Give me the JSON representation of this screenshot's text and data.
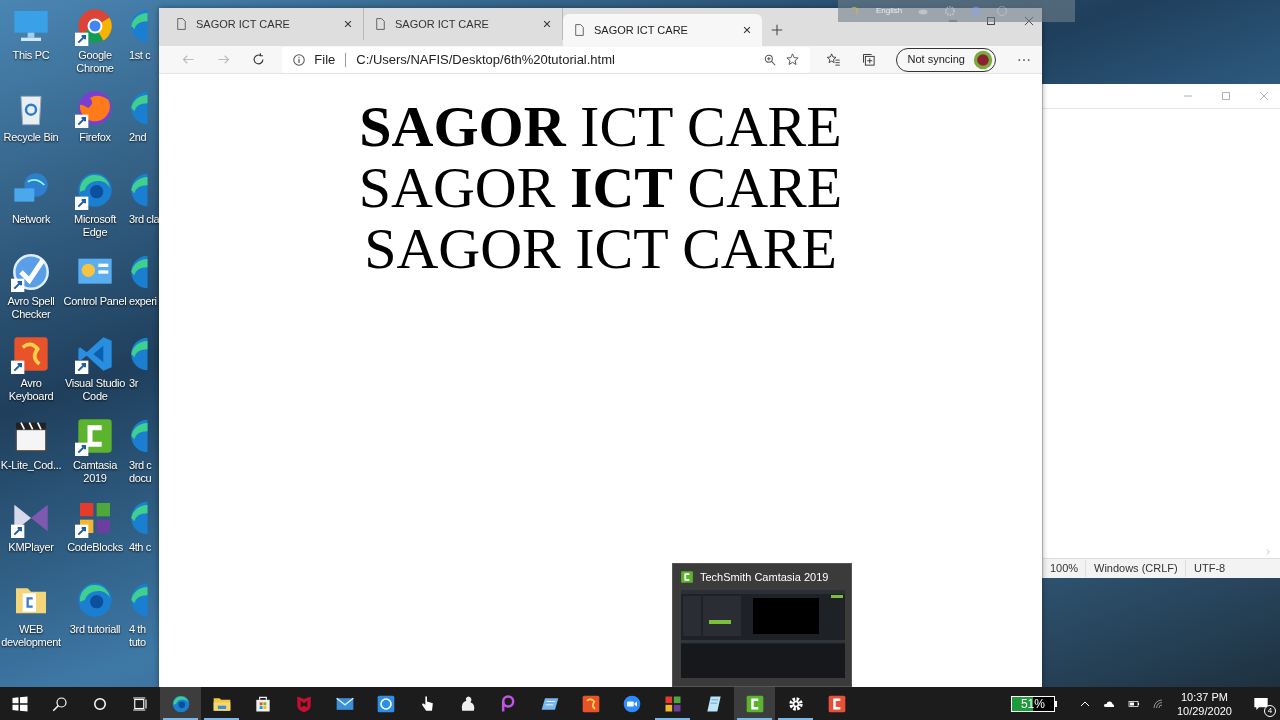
{
  "desktop": {
    "columns": [
      [
        "This PC",
        "Recycle Bin",
        "Network",
        "Avro Spell\nChecker",
        "Avro\nKeyboard",
        "K-Lite_Cod...",
        "KMPlayer",
        "WEB\ndevelopment"
      ],
      [
        "Google\nChrome",
        "Firefox",
        "Microsoft\nEdge",
        "Control Panel",
        "Visual Studio\nCode",
        "Camtasia\n2019",
        "CodeBlocks",
        "3rd tutoriall"
      ],
      [
        "1st c",
        "2nd",
        "3rd cla",
        "experi",
        "3r",
        "3rd c\ndocu",
        "4th c",
        "4 th\ntuto"
      ]
    ]
  },
  "language_bar": {
    "label": "English"
  },
  "notepad": {
    "status_bar": [
      "100%",
      "Windows (CRLF)",
      "UTF-8"
    ]
  },
  "browser": {
    "tabs": [
      {
        "title": "SAGOR ICT CARE",
        "selected": false
      },
      {
        "title": "SAGOR ICT CARE",
        "selected": false
      },
      {
        "title": "SAGOR ICT CARE",
        "selected": true
      }
    ],
    "back": {
      "disabled": true
    },
    "forward": {
      "disabled": true
    },
    "address": {
      "scheme": "File",
      "url": "C:/Users/NAFIS/Desktop/6th%20tutorial.html"
    },
    "profile": {
      "label": "Not syncing"
    },
    "page": {
      "lines": [
        "**SAGOR** ICT CARE",
        "SAGOR **ICT** CARE",
        "SAGOR ICT CARE"
      ]
    }
  },
  "taskbar_preview": {
    "title": "TechSmith Camtasia 2019"
  },
  "taskbar": {
    "apps": [
      {
        "running": true,
        "highlighted": true
      },
      {
        "running": true,
        "highlighted": false
      },
      {
        "running": false,
        "highlighted": false
      },
      {
        "running": false,
        "highlighted": false
      },
      {
        "running": false,
        "highlighted": false
      },
      {
        "running": false,
        "highlighted": false
      },
      {
        "running": false,
        "highlighted": false
      },
      {
        "running": false,
        "highlighted": false
      },
      {
        "running": false,
        "highlighted": false
      },
      {
        "running": false,
        "highlighted": false
      },
      {
        "running": false,
        "highlighted": false
      },
      {
        "running": false,
        "highlighted": false
      },
      {
        "running": true,
        "highlighted": false
      },
      {
        "running": false,
        "highlighted": false
      },
      {
        "running": true,
        "highlighted": true
      },
      {
        "running": true,
        "highlighted": false
      },
      {
        "running": false,
        "highlighted": false
      }
    ],
    "battery": {
      "level": 0.51,
      "reading": "51%"
    },
    "clock": {
      "time": "10:37 PM",
      "date": "10/29/2020"
    },
    "notifications": {
      "count": "4"
    }
  }
}
